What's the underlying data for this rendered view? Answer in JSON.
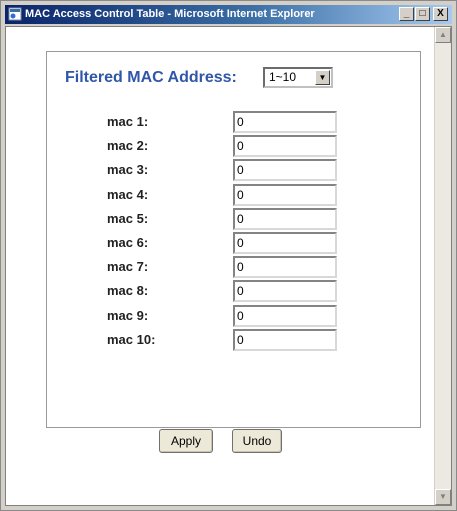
{
  "window": {
    "title": "MAC Access Control Table - Microsoft Internet Explorer",
    "controls": {
      "minimize": "_",
      "maximize": "□",
      "close": "X"
    }
  },
  "filter": {
    "label": "Filtered MAC Address:",
    "range_selected": "1~10"
  },
  "mac_entries": [
    {
      "label": "mac 1:",
      "value": "0"
    },
    {
      "label": "mac 2:",
      "value": "0"
    },
    {
      "label": "mac 3:",
      "value": "0"
    },
    {
      "label": "mac 4:",
      "value": "0"
    },
    {
      "label": "mac 5:",
      "value": "0"
    },
    {
      "label": "mac 6:",
      "value": "0"
    },
    {
      "label": "mac 7:",
      "value": "0"
    },
    {
      "label": "mac 8:",
      "value": "0"
    },
    {
      "label": "mac 9:",
      "value": "0"
    },
    {
      "label": "mac 10:",
      "value": "0"
    }
  ],
  "buttons": {
    "apply": "Apply",
    "undo": "Undo"
  },
  "icons": {
    "app": "ie-page-icon",
    "dropdown": "chevron-down-icon",
    "scroll_up": "arrow-up-icon",
    "scroll_down": "arrow-down-icon"
  }
}
